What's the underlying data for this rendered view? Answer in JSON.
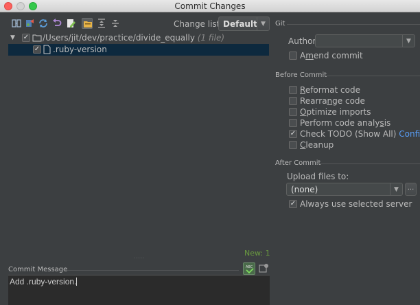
{
  "window": {
    "title": "Commit Changes"
  },
  "toolbar": {
    "icons": [
      "vcs-diff-icon",
      "revert-icon",
      "refresh-icon",
      "undo-icon",
      "edit-source-icon",
      "group-by-directory-icon",
      "expand-all-icon",
      "collapse-all-icon"
    ]
  },
  "changelist": {
    "label": "Change list:",
    "value": "Default"
  },
  "tree": {
    "root": {
      "path": "/Users/jit/dev/practice/divide_equally",
      "count": "(1 file)"
    },
    "file": {
      "name": ".ruby-version"
    }
  },
  "status": {
    "new_count": "New: 1"
  },
  "commit_message": {
    "label": "Commit Message",
    "value": "Add .ruby-version."
  },
  "git": {
    "section_title": "Git",
    "author_label": "Author:",
    "author_value": "",
    "amend_before": "A",
    "amend_underline": "m",
    "amend_after": "end commit"
  },
  "before_commit": {
    "section_title": "Before Commit",
    "options": [
      {
        "pre": "",
        "u": "R",
        "post": "eformat code",
        "checked": false
      },
      {
        "pre": "Rearra",
        "u": "n",
        "post": "ge code",
        "checked": false
      },
      {
        "pre": "",
        "u": "O",
        "post": "ptimize imports",
        "checked": false
      },
      {
        "pre": "Perform code analy",
        "u": "s",
        "post": "is",
        "checked": false
      },
      {
        "pre": "Check TODO (Show All) ",
        "u": "",
        "post": "",
        "checked": true,
        "link": "Configure"
      },
      {
        "pre": "",
        "u": "C",
        "post": "leanup",
        "checked": false
      }
    ]
  },
  "after_commit": {
    "section_title": "After Commit",
    "upload_label": "Upload files to:",
    "upload_value": "(none)",
    "browse_label": "...",
    "always_use_server": "Always use selected server",
    "always_use_checked": true
  },
  "colors": {
    "accent": "#589df6",
    "selection": "#0d293e",
    "new_count": "#6a9a40"
  }
}
